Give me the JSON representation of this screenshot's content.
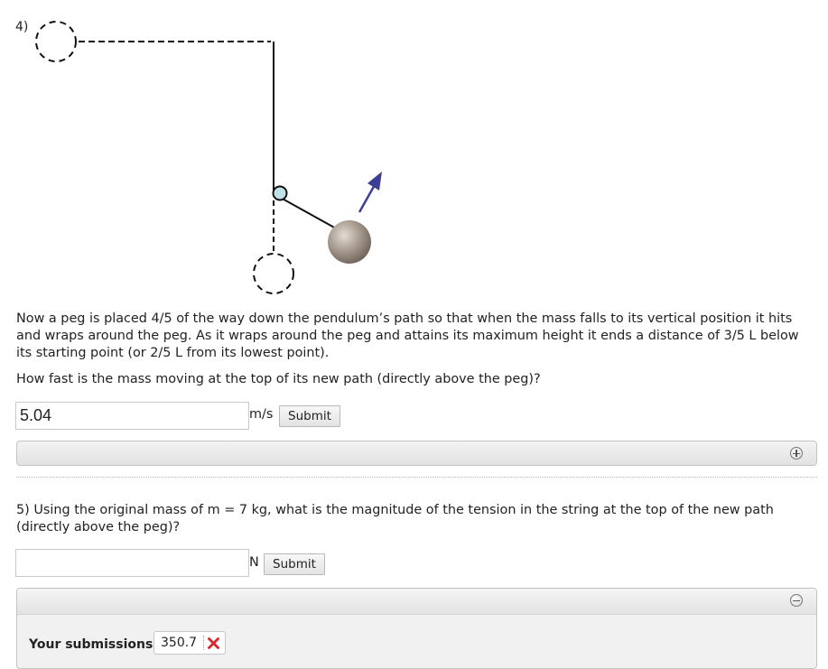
{
  "question4": {
    "number": "4)",
    "paragraph1": "Now a peg is placed 4/5 of the way down the pendulum’s path so that when the mass falls to its vertical position it hits and wraps around the peg. As it wraps around the peg and attains its maximum height it ends a distance of 3/5 L below its starting point (or 2/5 L from its lowest point).",
    "prompt": "How fast is the mass moving at the top of its new path (directly above the peg)?",
    "answer_value": "5.04",
    "unit": "m/s",
    "submit_label": "Submit",
    "feedback_toggle_icon": "plus-circle-icon"
  },
  "question5": {
    "number": "5)",
    "prompt": "Using the original mass of m = 7 kg, what is the magnitude of the tension in the string at the top of the new path (directly above the peg)?",
    "answer_value": "",
    "unit": "N",
    "submit_label": "Submit",
    "feedback_toggle_icon": "minus-circle-icon",
    "submissions_label": "Your submissions:",
    "submissions": [
      {
        "value": "350.7",
        "status": "incorrect",
        "status_icon": "red-x-icon"
      }
    ]
  },
  "colors": {
    "arrow": "#3b3e94",
    "peg_fill": "#bfe1e6",
    "bob": "#a3968a",
    "incorrect": "#d9262c"
  }
}
